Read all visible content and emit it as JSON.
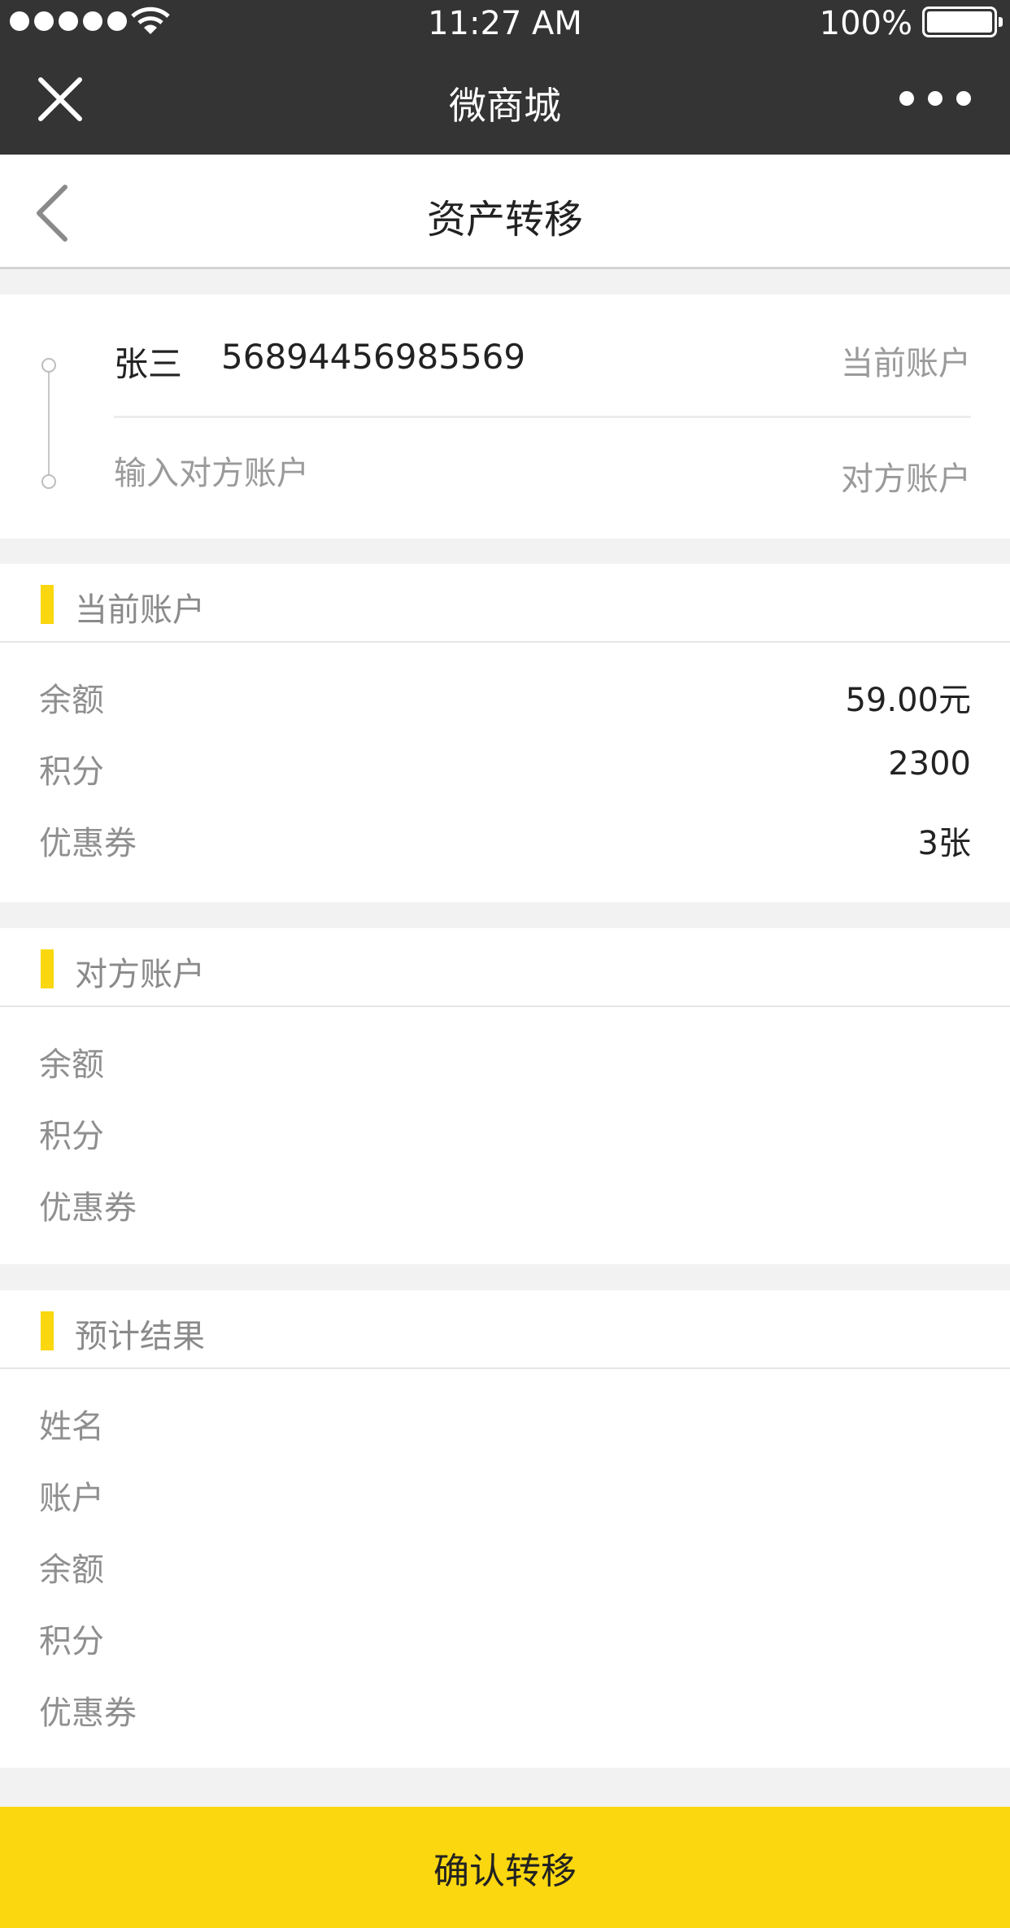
{
  "status_bar": {
    "time": "11:27 AM",
    "battery": "100%"
  },
  "wechat_bar": {
    "title": "微商城"
  },
  "header": {
    "title": "资产转移"
  },
  "transfer": {
    "current_name": "张三",
    "current_account": "56894456985569",
    "current_tag": "当前账户",
    "target_placeholder": "输入对方账户",
    "target_tag": "对方账户"
  },
  "current_account": {
    "title": "当前账户",
    "rows": [
      {
        "label": "余额",
        "value": "59.00元"
      },
      {
        "label": "积分",
        "value": "2300"
      },
      {
        "label": "优惠券",
        "value": "3张"
      }
    ]
  },
  "target_account": {
    "title": "对方账户",
    "rows": [
      {
        "label": "余额",
        "value": ""
      },
      {
        "label": "积分",
        "value": ""
      },
      {
        "label": "优惠券",
        "value": ""
      }
    ]
  },
  "estimate": {
    "title": "预计结果",
    "rows": [
      {
        "label": "姓名",
        "value": ""
      },
      {
        "label": "账户",
        "value": ""
      },
      {
        "label": "余额",
        "value": ""
      },
      {
        "label": "积分",
        "value": ""
      },
      {
        "label": "优惠券",
        "value": ""
      }
    ]
  },
  "confirm_label": "确认转移",
  "colors": {
    "accent": "#fad70f",
    "bar": "#343434",
    "muted": "#8f8f8f"
  }
}
